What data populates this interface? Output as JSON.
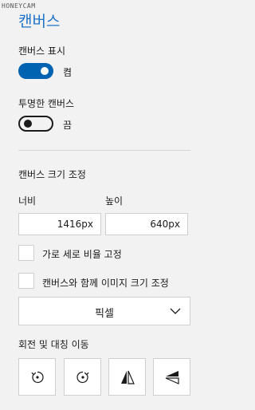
{
  "watermark": "HONEYCAM",
  "panel": {
    "title": "캔버스"
  },
  "show_canvas": {
    "label": "캔버스 표시",
    "state_text": "켬",
    "enabled": true
  },
  "transparent_canvas": {
    "label": "투명한 캔버스",
    "state_text": "끔",
    "enabled": false
  },
  "resize": {
    "section_title": "캔버스 크기 조정",
    "width_label": "너비",
    "height_label": "높이",
    "width_value": "1416px",
    "height_value": "640px",
    "lock_aspect_label": "가로 세로 비율 고정",
    "resize_image_label": "캔버스와 함께 이미지 크기 조정",
    "unit_selected": "픽셀"
  },
  "rotate_flip": {
    "section_title": "회전 및 대칭 이동",
    "buttons": [
      "rotate-left-icon",
      "rotate-right-icon",
      "flip-horizontal-icon",
      "flip-vertical-icon"
    ]
  },
  "colors": {
    "accent": "#0063b1",
    "title": "#1e72c7",
    "background": "#f2f2f2"
  }
}
